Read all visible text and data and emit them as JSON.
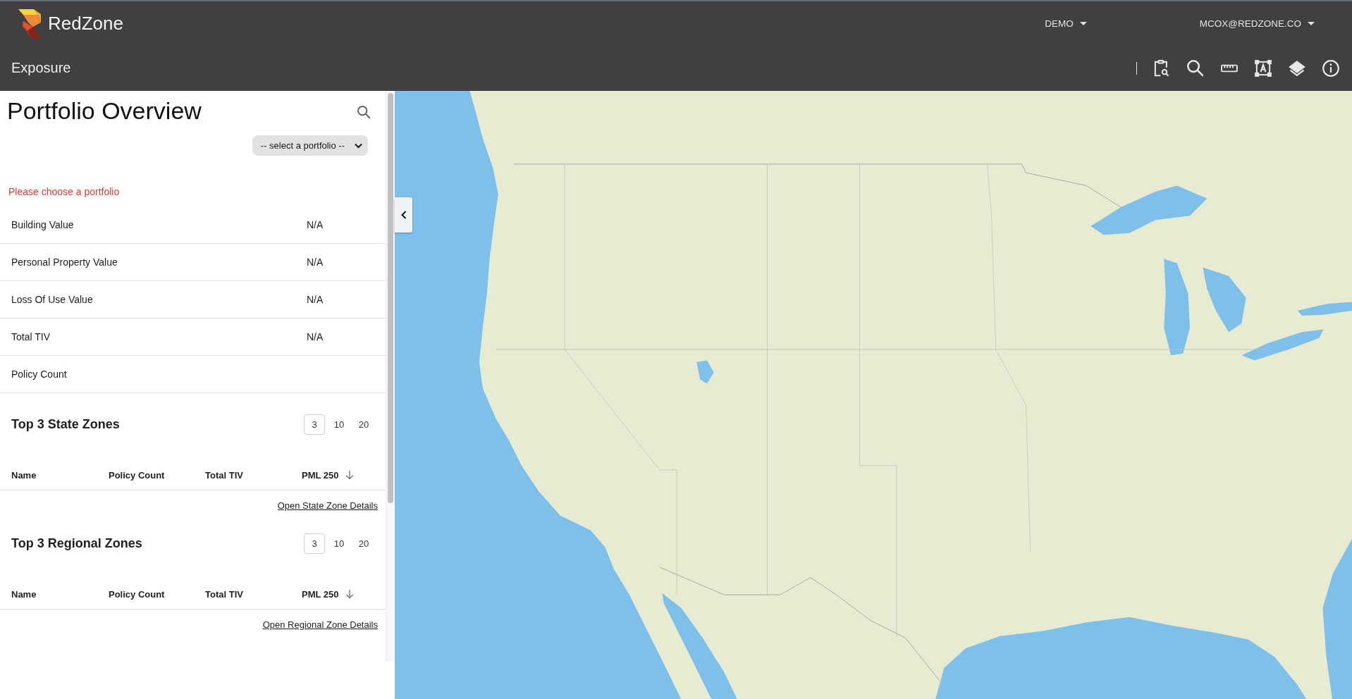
{
  "header": {
    "brand": "RedZone",
    "menus": [
      {
        "label": "DEMO"
      },
      {
        "label": "MCOX@REDZONE.CO"
      }
    ]
  },
  "toolbar": {
    "title": "Exposure"
  },
  "panel": {
    "title": "Portfolio Overview",
    "portfolio_select": {
      "placeholder": "-- select a portfolio --"
    },
    "message": "Please choose a portfolio",
    "summary": [
      {
        "label": "Building Value",
        "value": "N/A"
      },
      {
        "label": "Personal Property Value",
        "value": "N/A"
      },
      {
        "label": "Loss Of Use Value",
        "value": "N/A"
      },
      {
        "label": "Total TIV",
        "value": "N/A"
      },
      {
        "label": "Policy Count"
      }
    ],
    "sections": [
      {
        "title": "Top 3 State Zones",
        "page_sizes": [
          {
            "label": "3",
            "selected": true
          },
          {
            "label": "10",
            "selected": false
          },
          {
            "label": "20",
            "selected": false
          }
        ],
        "columns": [
          {
            "label": "Name",
            "sorted": false
          },
          {
            "label": "Policy Count",
            "sorted": false
          },
          {
            "label": "Total TIV",
            "sorted": false
          },
          {
            "label": "PML 250",
            "sorted": true
          }
        ],
        "link": "Open State Zone Details"
      },
      {
        "title": "Top 3 Regional Zones",
        "page_sizes": [
          {
            "label": "3",
            "selected": true
          },
          {
            "label": "10",
            "selected": false
          },
          {
            "label": "20",
            "selected": false
          }
        ],
        "columns": [
          {
            "label": "Name",
            "sorted": false
          },
          {
            "label": "Policy Count",
            "sorted": false
          },
          {
            "label": "Total TIV",
            "sorted": false
          },
          {
            "label": "PML 250",
            "sorted": true
          }
        ],
        "link": "Open Regional Zone Details"
      }
    ]
  }
}
